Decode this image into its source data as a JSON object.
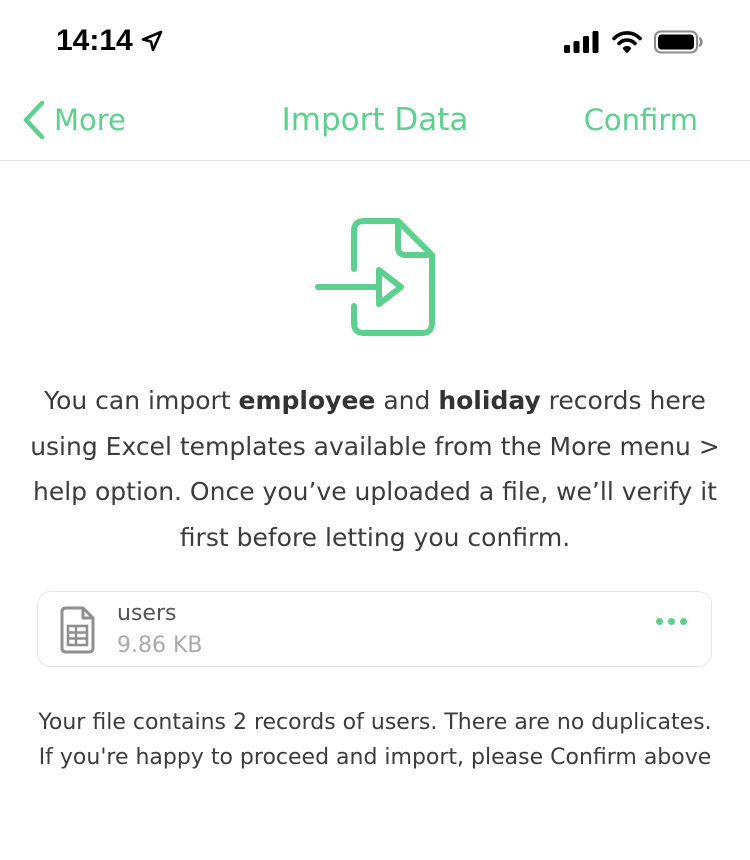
{
  "status_bar": {
    "time": "14:14",
    "location_icon": "location-arrow-icon",
    "signal_icon": "cellular-signal-icon",
    "wifi_icon": "wifi-icon",
    "battery_icon": "battery-icon"
  },
  "nav": {
    "back_label": "More",
    "title": "Import Data",
    "confirm_label": "Confirm"
  },
  "colors": {
    "accent": "#5dcf8e",
    "text": "#3c3c3c",
    "muted": "#aaaaaa",
    "border": "#e6e6e6"
  },
  "intro": {
    "part1": "You can import ",
    "bold1": "employee",
    "part2": " and ",
    "bold2": "holiday",
    "part3": " records here using Excel templates available from the More menu > help option.  Once you’ve uploaded a file, we’ll verify it first before letting you confirm."
  },
  "file": {
    "name": "users",
    "size": "9.86 KB",
    "icon": "spreadsheet-file-icon",
    "more_icon": "more-dots-icon"
  },
  "summary": "Your file contains 2 records of users. There are no duplicates. If you're happy to proceed and import, please Confirm above"
}
